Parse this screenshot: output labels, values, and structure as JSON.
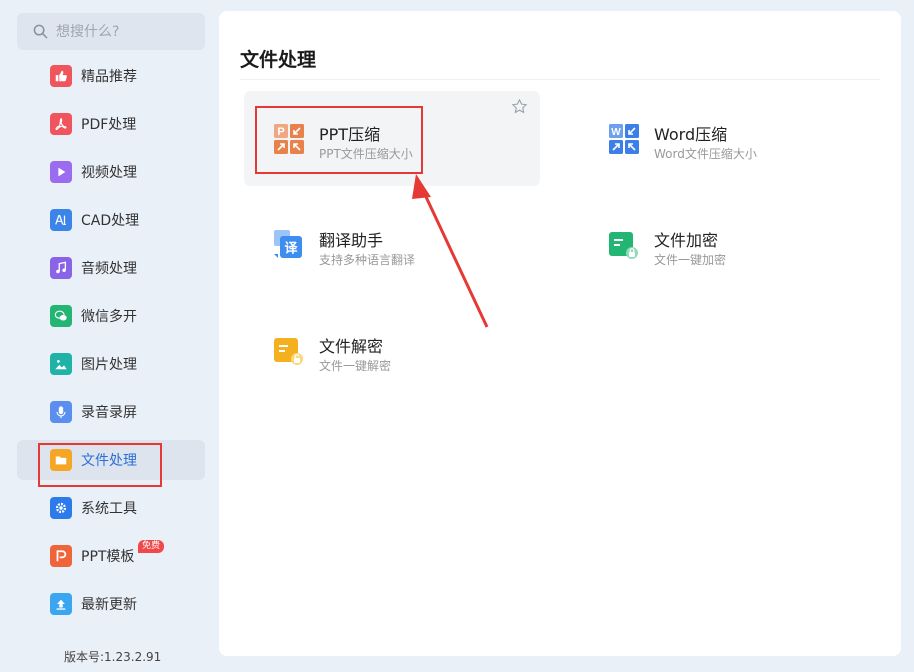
{
  "search": {
    "placeholder": "想搜什么?"
  },
  "sidebar": {
    "items": [
      {
        "label": "精品推荐",
        "icon": "thumbs-up-icon",
        "color": "#f0545c"
      },
      {
        "label": "PDF处理",
        "icon": "pdf-icon",
        "color": "#f0545c"
      },
      {
        "label": "视频处理",
        "icon": "play-icon",
        "color": "#9b6cf0"
      },
      {
        "label": "CAD处理",
        "icon": "cad-icon",
        "color": "#3d84ea"
      },
      {
        "label": "音频处理",
        "icon": "music-note-icon",
        "color": "#8a64e8"
      },
      {
        "label": "微信多开",
        "icon": "wechat-icon",
        "color": "#22b573"
      },
      {
        "label": "图片处理",
        "icon": "image-icon",
        "color": "#1fb3a8"
      },
      {
        "label": "录音录屏",
        "icon": "microphone-icon",
        "color": "#5a8ff0"
      },
      {
        "label": "文件处理",
        "icon": "folder-icon",
        "color": "#f5a623"
      },
      {
        "label": "系统工具",
        "icon": "gear-icon",
        "color": "#2d7bea"
      },
      {
        "label": "PPT模板",
        "icon": "ppt-template-icon",
        "color": "#f0643c",
        "badge": "免费"
      },
      {
        "label": "最新更新",
        "icon": "upload-icon",
        "color": "#3aa5f0"
      }
    ],
    "active_index": 8
  },
  "version": "版本号:1.23.2.91",
  "main": {
    "title": "文件处理",
    "tools": [
      {
        "name": "PPT压缩",
        "desc": "PPT文件压缩大小",
        "icon": "ppt-compress-icon"
      },
      {
        "name": "Word压缩",
        "desc": "Word文件压缩大小",
        "icon": "word-compress-icon"
      },
      {
        "name": "翻译助手",
        "desc": "支持多种语言翻译",
        "icon": "translate-icon"
      },
      {
        "name": "文件加密",
        "desc": "文件一键加密",
        "icon": "file-lock-icon"
      },
      {
        "name": "文件解密",
        "desc": "文件一键解密",
        "icon": "file-unlock-icon"
      }
    ]
  },
  "colors": {
    "accent": "#2b6fd6",
    "annotation": "#e53935",
    "ppt_orange": "#e8824a",
    "word_blue": "#3d7fe6",
    "translate_blue": "#3d8ef0",
    "lock_green": "#22b573",
    "unlock_yellow": "#f5b020"
  }
}
